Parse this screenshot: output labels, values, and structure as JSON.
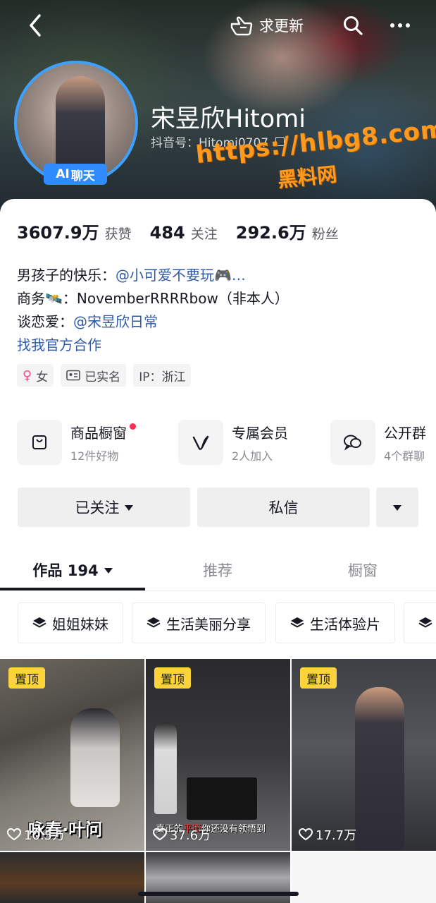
{
  "header": {
    "update_label": "求更新",
    "nickname": "宋昱欣Hitomi",
    "douyin_id": "抖音号：Hitomi0707",
    "ai_badge": {
      "ai": "AI",
      "label": "聊天"
    }
  },
  "watermark": {
    "url": "https://hlbg8.com",
    "name": "黑料网"
  },
  "stats": [
    {
      "value": "3607.9万",
      "label": "获赞"
    },
    {
      "value": "484",
      "label": "关注"
    },
    {
      "value": "292.6万",
      "label": "粉丝"
    }
  ],
  "bio": {
    "line1_prefix": "男孩子的快乐：",
    "line1_link": "@小可爱不要玩🎮…",
    "line2": "商务🛰️：NovemberRRRRbow（非本人）",
    "line3_prefix": "谈恋爱：",
    "line3_link": "@宋昱欣日常",
    "official_link": "找我官方合作"
  },
  "tags": {
    "gender": "女",
    "verified": "已实名",
    "ip": "IP：浙江"
  },
  "services": [
    {
      "title": "商品橱窗",
      "sub": "12件好物",
      "icon": "shopping-bag-icon"
    },
    {
      "title": "专属会员",
      "sub": "2人加入",
      "icon": "v-membership-icon"
    },
    {
      "title": "公开群",
      "sub": "4个群聊",
      "icon": "group-chat-icon"
    }
  ],
  "actions": {
    "followed": "已关注",
    "message": "私信"
  },
  "tabs": [
    {
      "label": "作品 194",
      "active": true
    },
    {
      "label": "推荐",
      "active": false
    },
    {
      "label": "橱窗",
      "active": false
    }
  ],
  "collections": [
    "姐姐妹妹",
    "生活美丽分享",
    "生活体验片"
  ],
  "videos": [
    {
      "pinned": "置顶",
      "likes": "10.5万",
      "caption": "咏春·叶问"
    },
    {
      "pinned": "置顶",
      "likes": "37.6万",
      "caption_a": "真正的",
      "caption_b": "平衡",
      "caption_c": "你还没有领悟到"
    },
    {
      "pinned": "置顶",
      "likes": "17.7万"
    }
  ],
  "colors": {
    "accent_blue": "#2f8bff",
    "link_blue": "#2f5aa8",
    "red_dot": "#fe2c55",
    "pin_yellow": "#fdd33b",
    "watermark_orange": "#ff9a1f"
  }
}
